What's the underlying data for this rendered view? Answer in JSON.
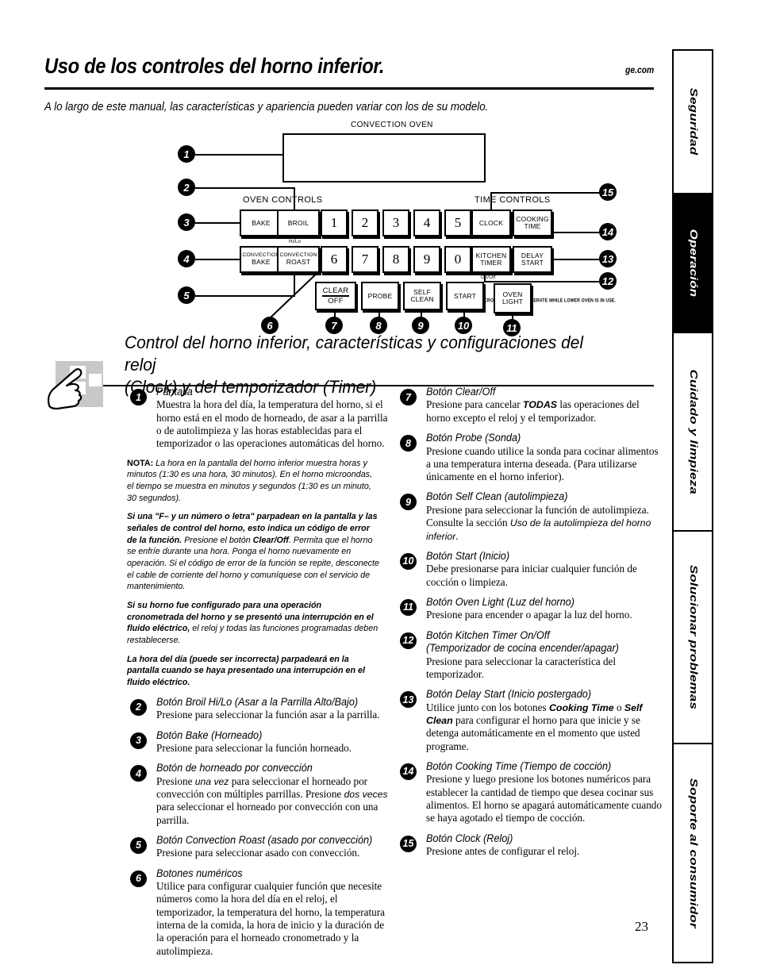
{
  "header": {
    "title": "Uso de los controles del horno inferior.",
    "url": "ge.com",
    "subtitle": "A lo largo de este manual, las características y apariencia pueden variar con los de su modelo."
  },
  "sidebar": {
    "tabs": [
      {
        "label": "Seguridad",
        "active": false
      },
      {
        "label": "Operación",
        "active": true
      },
      {
        "label": "Cuidado y limpieza",
        "active": false
      },
      {
        "label": "Solucionar problemas",
        "active": false
      },
      {
        "label": "Soporte al consumidor",
        "active": false
      }
    ]
  },
  "diagram": {
    "top_label": "Convection Oven",
    "oven_controls_label": "Oven Controls",
    "time_controls_label": "Time Controls",
    "hi_lo_label": "Hi/Lo",
    "on_off_label": "On/Off",
    "fineprint": "✖ MICROWAVE FAN MAY OPERATE WHILE LOWER OVEN IS IN USE.",
    "keys": {
      "bake": "Bake",
      "broil": "Broil",
      "convection_bake_line1": "Convection",
      "convection_bake_line2": "Bake",
      "convection_roast_line1": "Convection",
      "convection_roast_line2": "Roast",
      "clear": "Clear",
      "off": "Off",
      "probe": "Probe",
      "self": "Self",
      "clean": "Clean",
      "start": "Start",
      "clock": "Clock",
      "cooking": "Cooking",
      "time": "Time",
      "kitchen": "Kitchen",
      "timer": "Timer",
      "delay": "Delay",
      "start2": "Start",
      "oven": "Oven",
      "light": "Light"
    },
    "numbers": [
      "1",
      "2",
      "3",
      "4",
      "5",
      "6",
      "7",
      "8",
      "9",
      "0"
    ],
    "callouts": [
      "1",
      "2",
      "3",
      "4",
      "5",
      "6",
      "7",
      "8",
      "9",
      "10",
      "11",
      "12",
      "13",
      "14",
      "15"
    ]
  },
  "section": {
    "heading_line1": "Control del horno inferior, características y configuraciones del reloj",
    "heading_line2": "(Clock) y del temporizador (Timer)"
  },
  "left_column": {
    "item1": {
      "number": "1",
      "title": "Pantalla",
      "body": "Muestra la hora del día, la temperatura del horno, si el horno está en el modo de horneado, de asar a la parrilla o de autolimpieza y las horas establecidas para el temporizador o las operaciones automáticas del horno."
    },
    "note1_label": "NOTA:",
    "note1": " La hora en la pantalla del horno inferior muestra horas y minutos (1:30 es una hora, 30 minutos). En el horno microondas, el tiempo se muestra en minutos y segundos (1:30 es un minuto, 30 segundos).",
    "note2_bold": "Si una \"F– y un número o letra\" parpadean en la pantalla y las señales de control del horno, esto indica un código de error de la función.",
    "note2_rest_a": " Presione el botón ",
    "note2_rest_b": "Clear/Off",
    "note2_rest_c": ". Permita que el horno se enfríe durante una hora. Ponga el horno nuevamente en operación. Si el código de error de la función se repite, desconecte el cable de corriente del horno y comuníquese con el servicio de mantenimiento.",
    "note3_bold": "Si su horno fue configurado para una operación cronometrada del horno y se presentó una interrupción en el fluido eléctrico,",
    "note3_rest": " el reloj y todas las funciones programadas deben restablecerse.",
    "note4_bold": "La hora del día (puede ser incorrecta) parpadeará en la pantalla cuando se haya presentado una interrupción en el fluido eléctrico.",
    "item2": {
      "number": "2",
      "title": "Botón Broil Hi/Lo (Asar a la Parrilla Alto/Bajo)",
      "body": "Presione para seleccionar la función asar a la parrilla."
    },
    "item3": {
      "number": "3",
      "title": "Botón Bake (Horneado)",
      "body": "Presione para seleccionar la función horneado."
    },
    "item4": {
      "number": "4",
      "title": "Botón de horneado por convección",
      "body_a": "Presione ",
      "body_b": "una vez",
      "body_c": " para seleccionar el horneado por convección con múltiples parrillas. Presione ",
      "body_d": "dos veces",
      "body_e": " para seleccionar el horneado por convección con una parrilla."
    },
    "item5": {
      "number": "5",
      "title": "Botón Convection Roast (asado por convección)",
      "body": "Presione para seleccionar asado con convección."
    },
    "item6": {
      "number": "6",
      "title": "Botones numéricos",
      "body": "Utilice para configurar cualquier función que necesite números como la hora del día en el reloj, el temporizador, la temperatura del horno, la temperatura interna de la comida, la hora de inicio y la duración de la operación para el horneado cronometrado y la autolimpieza."
    }
  },
  "right_column": {
    "item7": {
      "number": "7",
      "title": "Botón Clear/Off",
      "body_a": "Presione para cancelar ",
      "body_b": "TODAS",
      "body_c": " las operaciones del horno excepto el reloj y el temporizador."
    },
    "item8": {
      "number": "8",
      "title": "Botón Probe (Sonda)",
      "body": "Presione cuando utilice la sonda para cocinar alimentos a una temperatura interna deseada. (Para utilizarse únicamente en el horno inferior)."
    },
    "item9": {
      "number": "9",
      "title": "Botón Self Clean (autolimpieza)",
      "body_a": "Presione para seleccionar la función de autolimpieza. Consulte la sección ",
      "body_b": "Uso de la autolimpieza del horno inferior",
      "body_c": "."
    },
    "item10": {
      "number": "10",
      "title": "Botón Start (Inicio)",
      "body": "Debe presionarse para iniciar cualquier función de cocción o limpieza."
    },
    "item11": {
      "number": "11",
      "title": "Botón Oven Light (Luz del horno)",
      "body": "Presione para encender o apagar la luz del horno."
    },
    "item12": {
      "number": "12",
      "title_line1": "Botón Kitchen Timer On/Off",
      "title_line2": "(Temporizador de cocina encender/apagar)",
      "body": "Presione para seleccionar la característica del temporizador."
    },
    "item13": {
      "number": "13",
      "title": "Botón Delay Start (Inicio postergado)",
      "body_a": "Utilice junto con los botones ",
      "body_b": "Cooking Time",
      "body_c": " o ",
      "body_d": "Self Clean",
      "body_e": " para configurar el horno para que inicie y se detenga automáticamente en el momento que usted programe."
    },
    "item14": {
      "number": "14",
      "title": "Botón Cooking Time (Tiempo de cocción)",
      "body": "Presione y luego presione los botones numéricos para establecer la cantidad de tiempo que desea cocinar sus alimentos. El horno se apagará automáticamente cuando se haya agotado el tiempo de cocción."
    },
    "item15": {
      "number": "15",
      "title": "Botón Clock (Reloj)",
      "body": "Presione antes de configurar el reloj."
    }
  },
  "footer": {
    "page_number": "23"
  }
}
